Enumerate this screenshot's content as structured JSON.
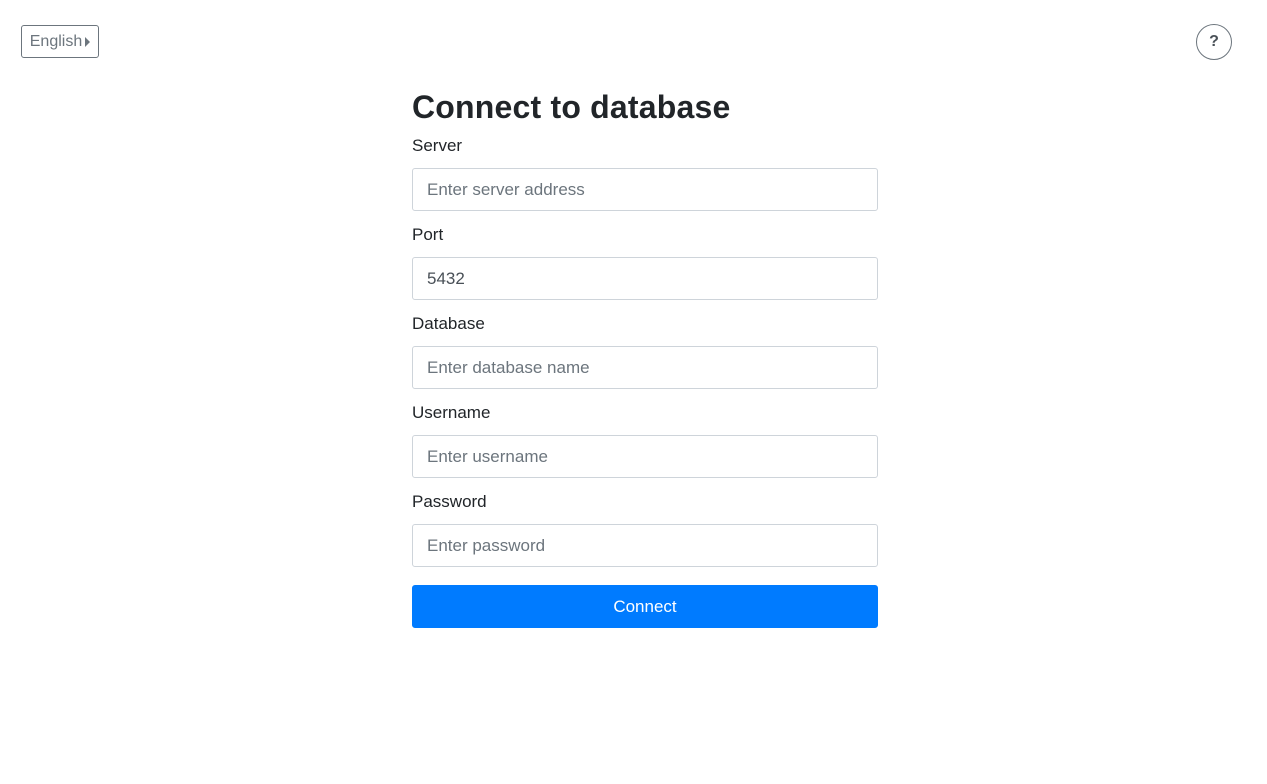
{
  "header": {
    "language_label": "English",
    "help_label": "?"
  },
  "form": {
    "title": "Connect to database",
    "server": {
      "label": "Server",
      "value": "",
      "placeholder": "Enter server address"
    },
    "port": {
      "label": "Port",
      "value": "5432",
      "placeholder": ""
    },
    "database": {
      "label": "Database",
      "value": "",
      "placeholder": "Enter database name"
    },
    "username": {
      "label": "Username",
      "value": "",
      "placeholder": "Enter username"
    },
    "password": {
      "label": "Password",
      "value": "",
      "placeholder": "Enter password"
    },
    "connect_label": "Connect"
  },
  "colors": {
    "primary": "#007bff",
    "secondary": "#6c757d"
  }
}
